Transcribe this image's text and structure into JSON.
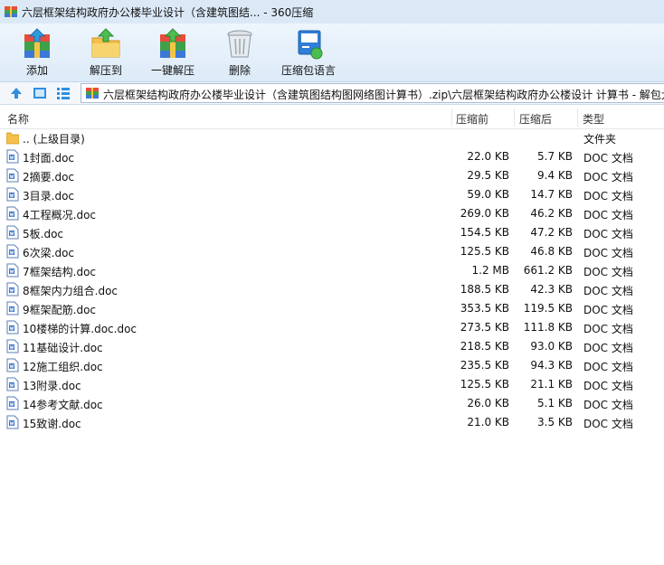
{
  "window": {
    "title": "六层框架结构政府办公楼毕业设计（含建筑图结... - 360压缩"
  },
  "toolbar": {
    "add": "添加",
    "extract_to": "解压到",
    "one_click_extract": "一键解压",
    "delete": "删除",
    "language_pack": "压缩包语言"
  },
  "address": {
    "path": "六层框架结构政府办公楼毕业设计（含建筑图结构图网络图计算书）.zip\\六层框架结构政府办公楼设计 计算书 - 解包大小为"
  },
  "columns": {
    "name": "名称",
    "original_size": "压缩前",
    "compressed_size": "压缩后",
    "type": "类型"
  },
  "parent_row": {
    "name": ".. (上级目录)",
    "type": "文件夹"
  },
  "files": [
    {
      "name": "1封面.doc",
      "original": "22.0 KB",
      "compressed": "5.7 KB",
      "type": "DOC 文档"
    },
    {
      "name": "2摘要.doc",
      "original": "29.5 KB",
      "compressed": "9.4 KB",
      "type": "DOC 文档"
    },
    {
      "name": "3目录.doc",
      "original": "59.0 KB",
      "compressed": "14.7 KB",
      "type": "DOC 文档"
    },
    {
      "name": "4工程概况.doc",
      "original": "269.0 KB",
      "compressed": "46.2 KB",
      "type": "DOC 文档"
    },
    {
      "name": "5板.doc",
      "original": "154.5 KB",
      "compressed": "47.2 KB",
      "type": "DOC 文档"
    },
    {
      "name": "6次梁.doc",
      "original": "125.5 KB",
      "compressed": "46.8 KB",
      "type": "DOC 文档"
    },
    {
      "name": "7框架结构.doc",
      "original": "1.2 MB",
      "compressed": "661.2 KB",
      "type": "DOC 文档"
    },
    {
      "name": "8框架内力组合.doc",
      "original": "188.5 KB",
      "compressed": "42.3 KB",
      "type": "DOC 文档"
    },
    {
      "name": "9框架配筋.doc",
      "original": "353.5 KB",
      "compressed": "119.5 KB",
      "type": "DOC 文档"
    },
    {
      "name": "10楼梯的计算.doc.doc",
      "original": "273.5 KB",
      "compressed": "111.8 KB",
      "type": "DOC 文档"
    },
    {
      "name": "11基础设计.doc",
      "original": "218.5 KB",
      "compressed": "93.0 KB",
      "type": "DOC 文档"
    },
    {
      "name": "12施工组织.doc",
      "original": "235.5 KB",
      "compressed": "94.3 KB",
      "type": "DOC 文档"
    },
    {
      "name": "13附录.doc",
      "original": "125.5 KB",
      "compressed": "21.1 KB",
      "type": "DOC 文档"
    },
    {
      "name": "14参考文献.doc",
      "original": "26.0 KB",
      "compressed": "5.1 KB",
      "type": "DOC 文档"
    },
    {
      "name": "15致谢.doc",
      "original": "21.0 KB",
      "compressed": "3.5 KB",
      "type": "DOC 文档"
    }
  ],
  "icons": {
    "app": "archive-app-icon",
    "add": "archive-add-icon",
    "extract_to": "folder-extract-icon",
    "one_click_extract": "archive-extract-icon",
    "delete": "trash-bin-icon",
    "language_pack": "code-page-icon",
    "nav_up": "up-arrow-icon",
    "nav_view": "view-icon",
    "nav_list": "list-view-icon",
    "folder": "folder-icon",
    "doc": "doc-file-icon"
  },
  "colors": {
    "accent": "#2f7ed8",
    "titlebar": "#dbe9f7"
  }
}
